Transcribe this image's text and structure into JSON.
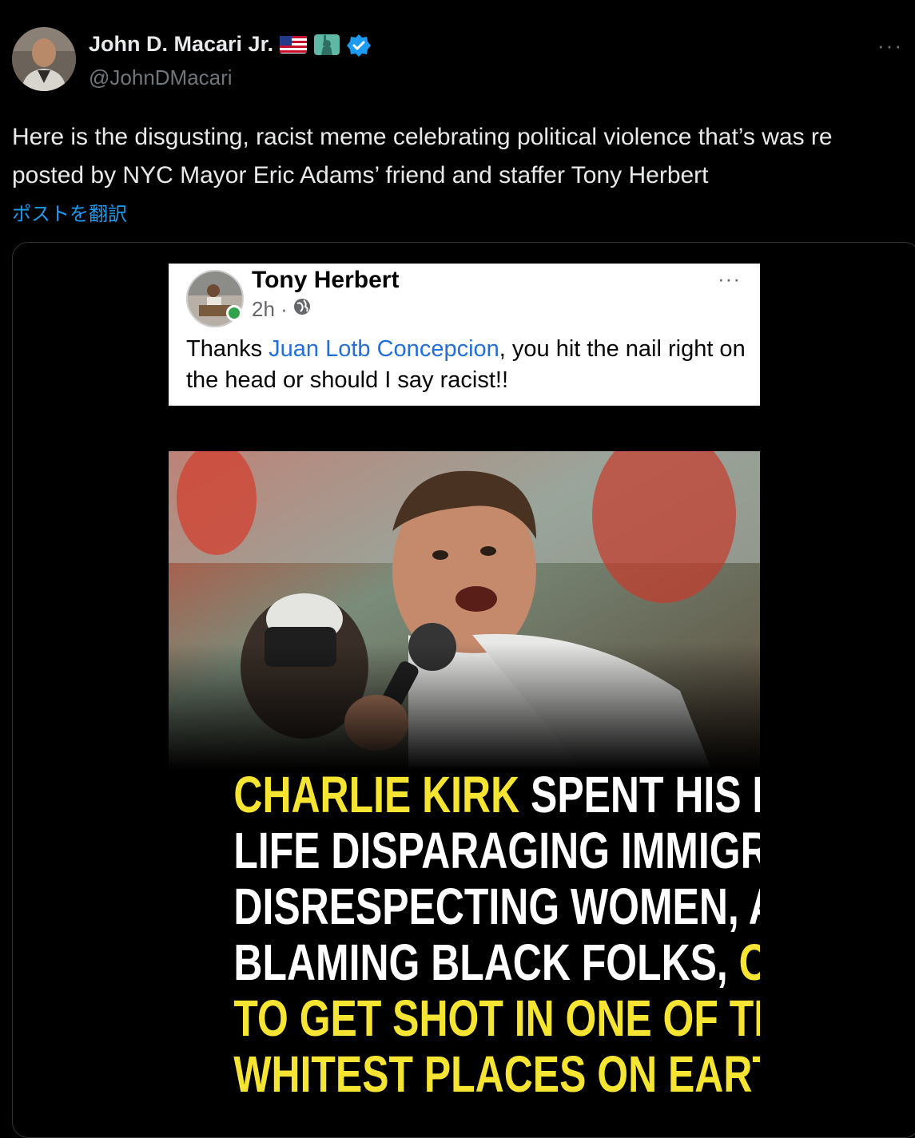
{
  "author": {
    "name": "John D. Macari Jr.",
    "handle": "@JohnDMacari",
    "flag_icon": "us-flag-icon",
    "liberty_icon": "statue-of-liberty-icon",
    "verified_icon": "verified-badge-icon",
    "more_label": "···"
  },
  "tweet": {
    "text": "Here is the disgusting, racist meme celebrating political violence that’s was re posted by NYC Mayor Eric Adams’ friend and staffer Tony Herbert",
    "translate_label": "ポストを翻訳"
  },
  "embedded_post": {
    "name": "Tony Herbert",
    "time": "2h ·",
    "more_label": "···",
    "text_before": "Thanks ",
    "link_text": "Juan Lotb Concepcion",
    "text_after": ", you hit the nail right on the head or should I say racist!!"
  },
  "meme": {
    "line1_yellow": "CHARLIE KIRK",
    "line1_white": " SPENT HIS ENTIRE",
    "line2": "LIFE DISPARAGING IMMIGRANTS,",
    "line3": "DISRESPECTING WOMEN, AND",
    "line4_white": "BLAMING BLACK FOLKS, ",
    "line4_yellow": "ONLY",
    "line5": "TO GET SHOT IN ONE OF THE",
    "line6": "WHITEST PLACES ON EARTH."
  },
  "colors": {
    "background": "#000000",
    "text": "#e7e9ea",
    "muted": "#71767b",
    "link": "#1d9bf0",
    "verified": "#1d9bf0",
    "meme_yellow": "#f5e532"
  }
}
